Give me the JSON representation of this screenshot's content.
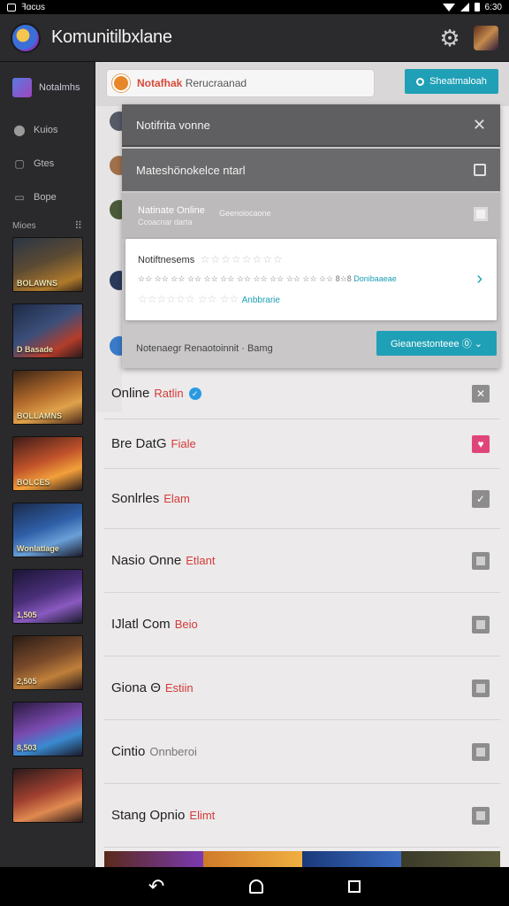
{
  "status_bar": {
    "app_label": "ꟻɑcʊs",
    "time": "6:30"
  },
  "app_bar": {
    "title": "Komunitilbxlane",
    "settings_icon": "gear-icon",
    "profile_icon": "avatar"
  },
  "sidebar": {
    "items": [
      {
        "label": "Notalmhs",
        "icon": "home-icon"
      },
      {
        "label": "Kuios",
        "icon": "shield-icon"
      },
      {
        "label": "Gtes",
        "icon": "calendar-icon"
      },
      {
        "label": "Bope",
        "icon": "chat-icon"
      }
    ],
    "section_label": "Mioes",
    "section_more": "⠿",
    "thumbnails": [
      {
        "label": "BOLAWNS"
      },
      {
        "label": "D Basade"
      },
      {
        "label": "BOLLAMNS"
      },
      {
        "label": "BOLCES"
      },
      {
        "label": "Wonlatlage"
      },
      {
        "label": "1,505"
      },
      {
        "label": "2,505"
      },
      {
        "label": "8,503"
      },
      {
        "label": ""
      }
    ]
  },
  "search": {
    "prefix": "Notafhak",
    "text": "Rerucraanad"
  },
  "top_button": {
    "label": "Sheatmaloah"
  },
  "dropdown": {
    "row1": {
      "label": "Notifrita vonne"
    },
    "row2": {
      "label": "Mateshönokelce ntarl"
    },
    "row3": {
      "title": "Natinate Online",
      "subtitle": "Ccoacnar darta",
      "side": "Geenoiocaone"
    },
    "rating_card": {
      "title": "Notiftnesems",
      "stars": "☆☆☆☆☆☆☆☆",
      "line": "☆☆ ☆☆ ☆☆ ☆☆ ☆☆ ☆☆ ☆☆ ☆☆ ☆☆ ☆☆ ☆☆ ☆☆ 8☆8",
      "link": "Donibaaeae",
      "line2": "☆☆☆☆☆☆ ☆☆ ☆☆",
      "link2": "Anbbrarie"
    },
    "footer_text": "Notenaegr Renaotoinnit · Bamg",
    "cta_label": "Gieanestonteee ⓪ ⌄"
  },
  "list": [
    {
      "name": "Online",
      "tag": "Ratlin",
      "verified": true,
      "control": "x"
    },
    {
      "name": "Bre DatG",
      "tag": "Fiale",
      "verified": false,
      "control": "pink"
    },
    {
      "name": "Sonlrles",
      "tag": "Elam",
      "verified": false,
      "control": "check"
    },
    {
      "name": "Nasio Onne",
      "tag": "Etlant",
      "verified": false,
      "control": "box"
    },
    {
      "name": "IJlatl Com",
      "tag": "Beio",
      "verified": false,
      "control": "box"
    },
    {
      "name": "Giona Θ",
      "tag": "Estiin",
      "verified": false,
      "control": "box"
    },
    {
      "name": "Cintio",
      "tag": "Onnberoi",
      "verified": false,
      "control": "box"
    },
    {
      "name": "Stang Opnio",
      "tag": "Elimt",
      "verified": false,
      "control": "box"
    }
  ],
  "colors": {
    "accent": "#1fa0b6",
    "tag_red": "#d43a3a",
    "sidebar_bg": "#2a2a2c",
    "main_bg": "#eceaea"
  }
}
